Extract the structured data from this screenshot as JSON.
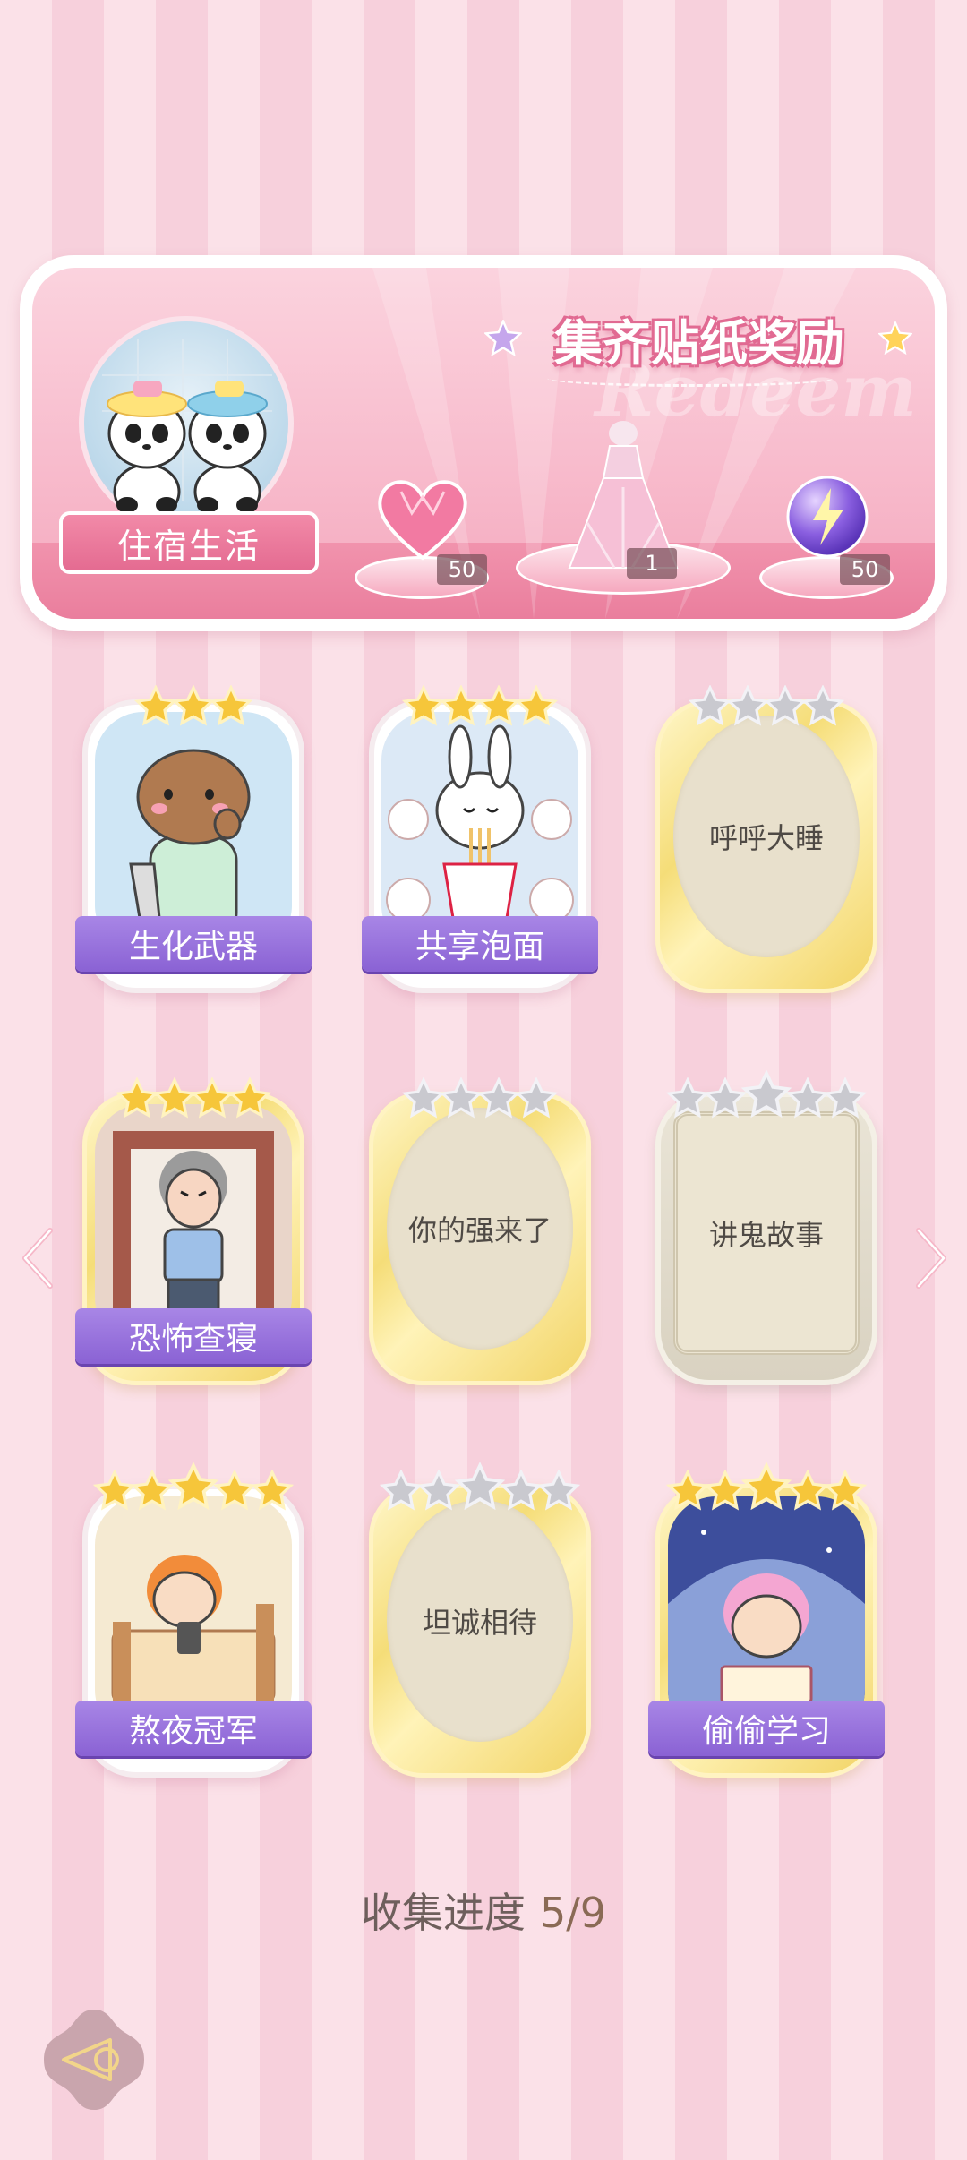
{
  "banner": {
    "title": "集齐贴纸奖励",
    "watermark": "Redeem",
    "theme_label": "住宿生活",
    "rewards": [
      {
        "icon": "pink-heart-gem-icon",
        "count": "50"
      },
      {
        "icon": "princess-dress-icon",
        "count": "1"
      },
      {
        "icon": "purple-energy-orb-icon",
        "count": "50"
      }
    ]
  },
  "stickers": [
    {
      "name": "生化武器",
      "collected": true,
      "stars": 3,
      "art": "capybara-pajamas"
    },
    {
      "name": "共享泡面",
      "collected": true,
      "stars": 4,
      "art": "bunny-instant-noodles"
    },
    {
      "name": "呼呼大睡",
      "collected": false,
      "stars": 4,
      "frame": "gold"
    },
    {
      "name": "恐怖查寝",
      "collected": true,
      "stars": 4,
      "art": "dorm-auntie-inspection"
    },
    {
      "name": "你的强来了",
      "collected": false,
      "stars": 4,
      "frame": "gold"
    },
    {
      "name": "讲鬼故事",
      "collected": false,
      "stars": 5,
      "frame": "silver"
    },
    {
      "name": "熬夜冠军",
      "collected": true,
      "stars": 5,
      "art": "boy-in-bed-phone"
    },
    {
      "name": "坦诚相待",
      "collected": false,
      "stars": 5,
      "frame": "gold"
    },
    {
      "name": "偷偷学习",
      "collected": true,
      "stars": 5,
      "art": "boy-under-blanket-reading"
    }
  ],
  "progress": {
    "label": "收集进度",
    "value": "5/9"
  },
  "colors": {
    "accent_pink": "#e46b91",
    "label_purple": "#8a62d4",
    "star_gold": "#f6c63a",
    "star_gray": "#c9c9cf"
  }
}
